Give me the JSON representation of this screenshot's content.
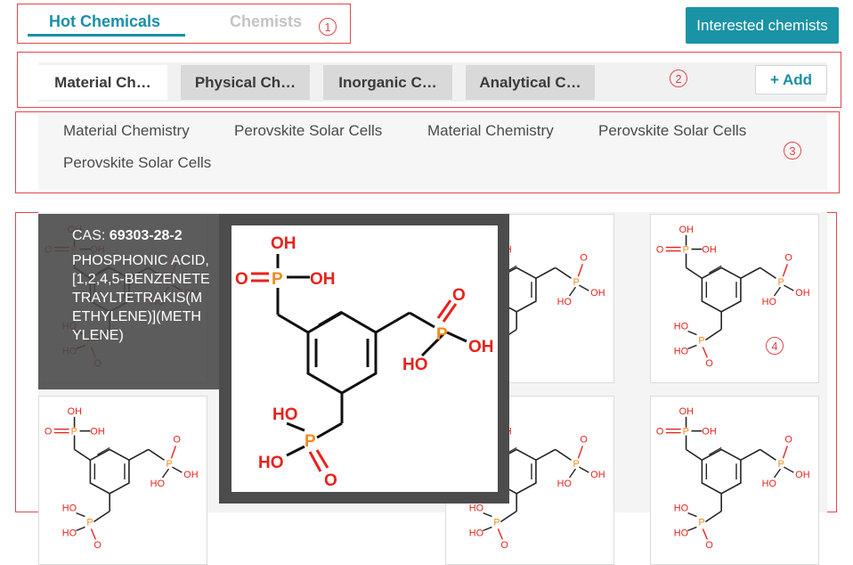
{
  "top_tabs": [
    {
      "label": "Hot Chemicals",
      "active": true
    },
    {
      "label": "Chemists",
      "active": false
    }
  ],
  "interested_button": "Interested chemists",
  "category_tabs": [
    {
      "label": "Material Ch…",
      "active": true
    },
    {
      "label": "Physical Ch…",
      "active": false
    },
    {
      "label": "Inorganic C…",
      "active": false
    },
    {
      "label": "Analytical C…",
      "active": false
    }
  ],
  "add_button": "+ Add",
  "sub_topics": [
    "Material Chemistry",
    "Perovskite Solar Cells",
    "Material Chemistry",
    "Perovskite Solar Cells",
    "Perovskite Solar Cells"
  ],
  "annotations": [
    "1",
    "2",
    "3",
    "4"
  ],
  "hover_card": {
    "cas_label": "CAS: ",
    "cas_number": "69303-28-2",
    "name": "PHOSPHONIC ACID, [1,2,4,5-BENZENETETRAYLTETRAKIS(METHYLENE)](METHYLENE)"
  },
  "molecule_labels": {
    "oh": "OH",
    "ho": "HO",
    "p": "P",
    "o": "O"
  },
  "colors": {
    "accent": "#1a8fa8",
    "annotation": "#e0474c",
    "oxygen": "#e8221b",
    "phosphorus": "#f28a1d"
  }
}
